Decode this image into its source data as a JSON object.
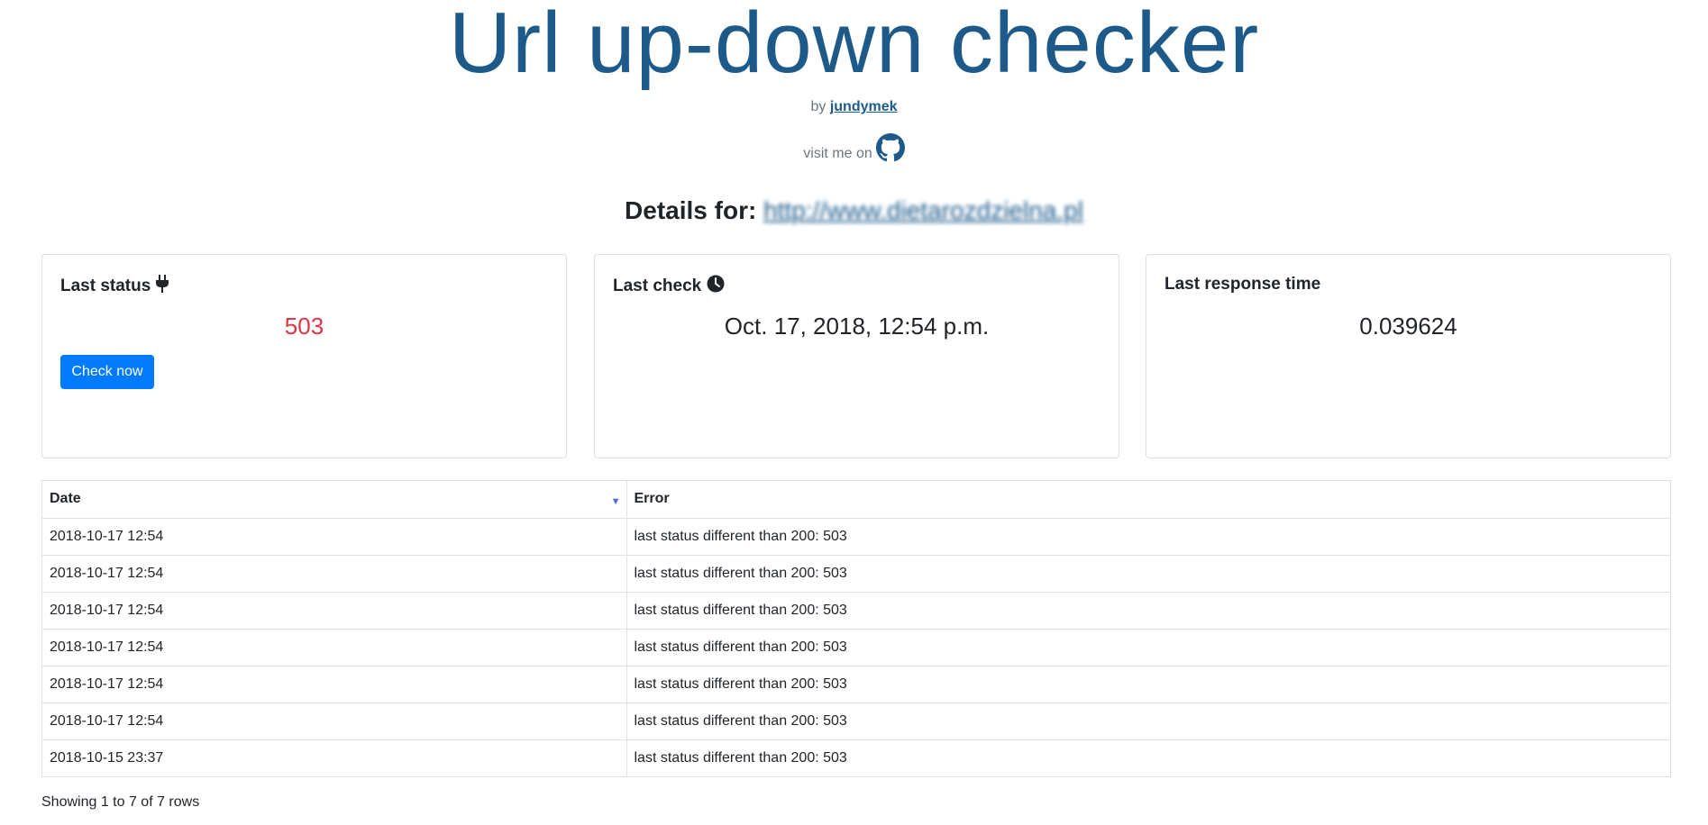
{
  "header": {
    "title": "Url up-down checker",
    "by_prefix": "by",
    "author": "jundymek",
    "visit_text": "visit me on"
  },
  "details": {
    "label": "Details for:",
    "url": "http://www.dietarozdzielna.pl"
  },
  "cards": {
    "last_status": {
      "title": "Last status",
      "value": "503",
      "button_label": "Check now",
      "icon": "plug-icon",
      "value_color": "#dc3545"
    },
    "last_check": {
      "title": "Last check",
      "value": "Oct. 17, 2018, 12:54 p.m.",
      "icon": "clock-icon"
    },
    "last_response": {
      "title": "Last response time",
      "value": "0.039624"
    }
  },
  "table": {
    "columns": [
      "Date",
      "Error"
    ],
    "rows": [
      [
        "2018-10-17 12:54",
        "last status different than 200: 503"
      ],
      [
        "2018-10-17 12:54",
        "last status different than 200: 503"
      ],
      [
        "2018-10-17 12:54",
        "last status different than 200: 503"
      ],
      [
        "2018-10-17 12:54",
        "last status different than 200: 503"
      ],
      [
        "2018-10-17 12:54",
        "last status different than 200: 503"
      ],
      [
        "2018-10-17 12:54",
        "last status different than 200: 503"
      ],
      [
        "2018-10-15 23:37",
        "last status different than 200: 503"
      ]
    ],
    "footer": "Showing 1 to 7 of 7 rows"
  },
  "colors": {
    "title": "#1d5a8a",
    "primary_button": "#007bff",
    "error": "#dc3545"
  }
}
